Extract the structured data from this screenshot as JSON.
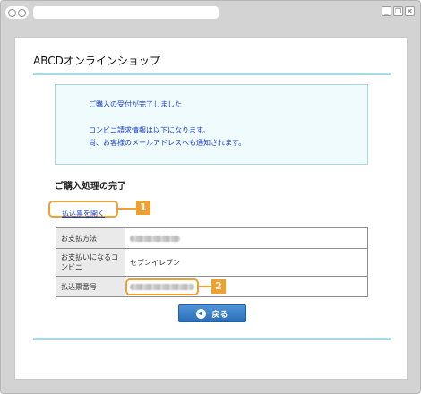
{
  "browser": {
    "window_controls": [
      "_",
      "❐",
      "✕"
    ]
  },
  "page": {
    "shop_title": "ABCDオンラインショップ",
    "notice": {
      "line1": "ご購入の受付が完了しました",
      "line2": "コンビニ請求情報は以下になります。",
      "line3": "尚、お客様のメールアドレスへも通知されます。"
    },
    "section_title": "ご購入処理の完了",
    "open_slip_link": "払込票を開く",
    "callouts": {
      "one": "1",
      "two": "2"
    },
    "table": {
      "rows": [
        {
          "label": "お支払方法",
          "value": ""
        },
        {
          "label": "お支払いになるコンビニ",
          "value": "セブンイレブン"
        },
        {
          "label": "払込票番号",
          "value": ""
        }
      ]
    },
    "back_button": "戻る",
    "colors": {
      "accent_rule": "#a8d8e4",
      "callout": "#f0a030",
      "link": "#1a3fc4",
      "notice_text": "#1c3fd0",
      "button": "#2c6fb8"
    }
  }
}
